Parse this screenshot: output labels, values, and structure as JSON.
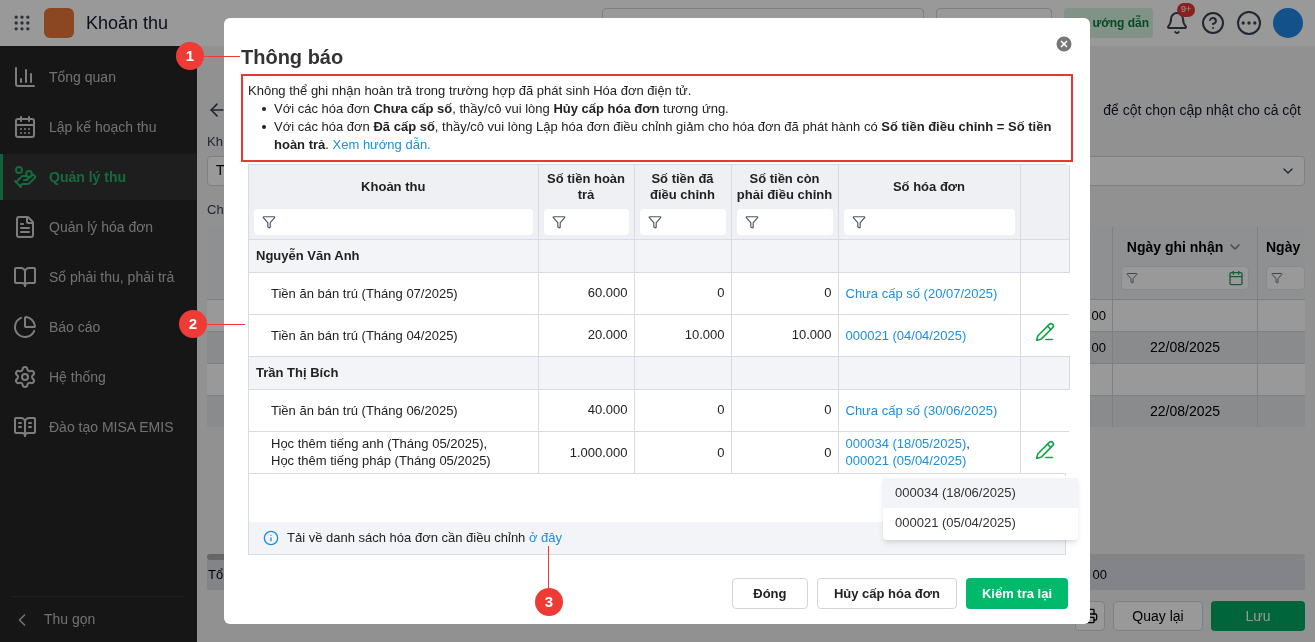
{
  "app": {
    "title": "Khoản thu",
    "help_button": "ướng dẫn",
    "notification_badge": "9+"
  },
  "sidebar": {
    "items": [
      {
        "label": "Tổng quan",
        "selected": false
      },
      {
        "label": "Lập kế hoạch thu",
        "selected": false
      },
      {
        "label": "Quản lý thu",
        "selected": true
      },
      {
        "label": "Quản lý hóa đơn",
        "selected": false
      },
      {
        "label": "Sổ phải thu, phải trả",
        "selected": false
      },
      {
        "label": "Báo cáo",
        "selected": false
      },
      {
        "label": "Hệ thống",
        "selected": false
      },
      {
        "label": "Đào tạo MISA EMIS",
        "selected": false
      }
    ],
    "collapse": "Thu gọn"
  },
  "background": {
    "hint": "để cột chọn cập nhật cho cả cột",
    "label_1": "Kh",
    "select_value": "T",
    "label_2": "Ch",
    "columns": [
      "Ngày ghi nhận",
      "Ngày"
    ],
    "rows": [
      {
        "kind": "group",
        "amount": "00"
      },
      {
        "kind": "item",
        "amount": "00",
        "date": "22/08/2025"
      },
      {
        "kind": "group"
      },
      {
        "kind": "item",
        "date": "22/08/2025"
      }
    ],
    "total_label": "Tổ",
    "total_amount": "00",
    "back_button": "Quay lại",
    "save_button": "Lưu"
  },
  "dialog": {
    "title": "Thông báo",
    "notice": {
      "intro": "Không thể ghi nhận hoàn trả trong trường hợp đã phát sinh Hóa đơn điện tử.",
      "bullets": [
        {
          "text": "Với các hóa đơn **Chưa cấp số**, thầy/cô vui lòng **Hủy cấp hóa đơn** tương ứng."
        },
        {
          "text": "Với các hóa đơn **Đã cấp số**, thầy/cô vui lòng Lập hóa đơn điều chỉnh giảm cho hóa đơn đã phát hành có **Số tiền điều chỉnh = Số tiền hoàn trả**.",
          "link": "Xem hướng dẫn."
        }
      ]
    },
    "table": {
      "columns": [
        {
          "label": "Khoản thu",
          "filter": true
        },
        {
          "label": "Số tiền hoàn trả",
          "filter": true
        },
        {
          "label": "Số tiền đã điều chỉnh",
          "filter": true
        },
        {
          "label": "Số tiền còn phải điều chỉnh",
          "filter": true
        },
        {
          "label": "Số hóa đơn",
          "filter": true
        },
        {
          "filter": false
        }
      ],
      "groups": [
        {
          "name": "Nguyễn Văn Anh",
          "rows": [
            {
              "item": [
                "Tiền ăn bán trú (Tháng 07/2025)"
              ],
              "refund": "60.000",
              "adjusted": "0",
              "remaining": "0",
              "invoices": [
                "Chưa cấp số (20/07/2025)"
              ],
              "editable": false
            },
            {
              "item": [
                "Tiền ăn bán trú (Tháng 04/2025)"
              ],
              "refund": "20.000",
              "adjusted": "10.000",
              "remaining": "10.000",
              "invoices": [
                "000021 (04/04/2025)"
              ],
              "editable": true
            }
          ]
        },
        {
          "name": "Trần Thị Bích",
          "rows": [
            {
              "item": [
                "Tiền ăn bán trú (Tháng 06/2025)"
              ],
              "refund": "40.000",
              "adjusted": "0",
              "remaining": "0",
              "invoices": [
                "Chưa cấp số (30/06/2025)"
              ],
              "editable": false
            },
            {
              "item": [
                "Học thêm tiếng anh (Tháng 05/2025),",
                "Học thêm tiếng pháp (Tháng 05/2025)"
              ],
              "refund": "1.000.000",
              "adjusted": "0",
              "remaining": "0",
              "invoices": [
                "000034 (18/05/2025)",
                "000021 (05/04/2025)"
              ],
              "separator": ",",
              "editable": true
            }
          ]
        }
      ]
    },
    "info": {
      "text": "Tải về danh sách hóa đơn cần điều chỉnh",
      "link": "ở đây"
    },
    "popup": [
      {
        "label": "000034 (18/06/2025)",
        "selected": true
      },
      {
        "label": "000021 (05/04/2025)",
        "selected": false
      }
    ],
    "buttons": [
      {
        "label": "Đóng",
        "kind": "secondary"
      },
      {
        "label": "Hủy cấp hóa đơn",
        "kind": "secondary"
      },
      {
        "label": "Kiểm tra lại",
        "kind": "primary"
      }
    ]
  },
  "annotations": [
    "1",
    "2",
    "3"
  ]
}
